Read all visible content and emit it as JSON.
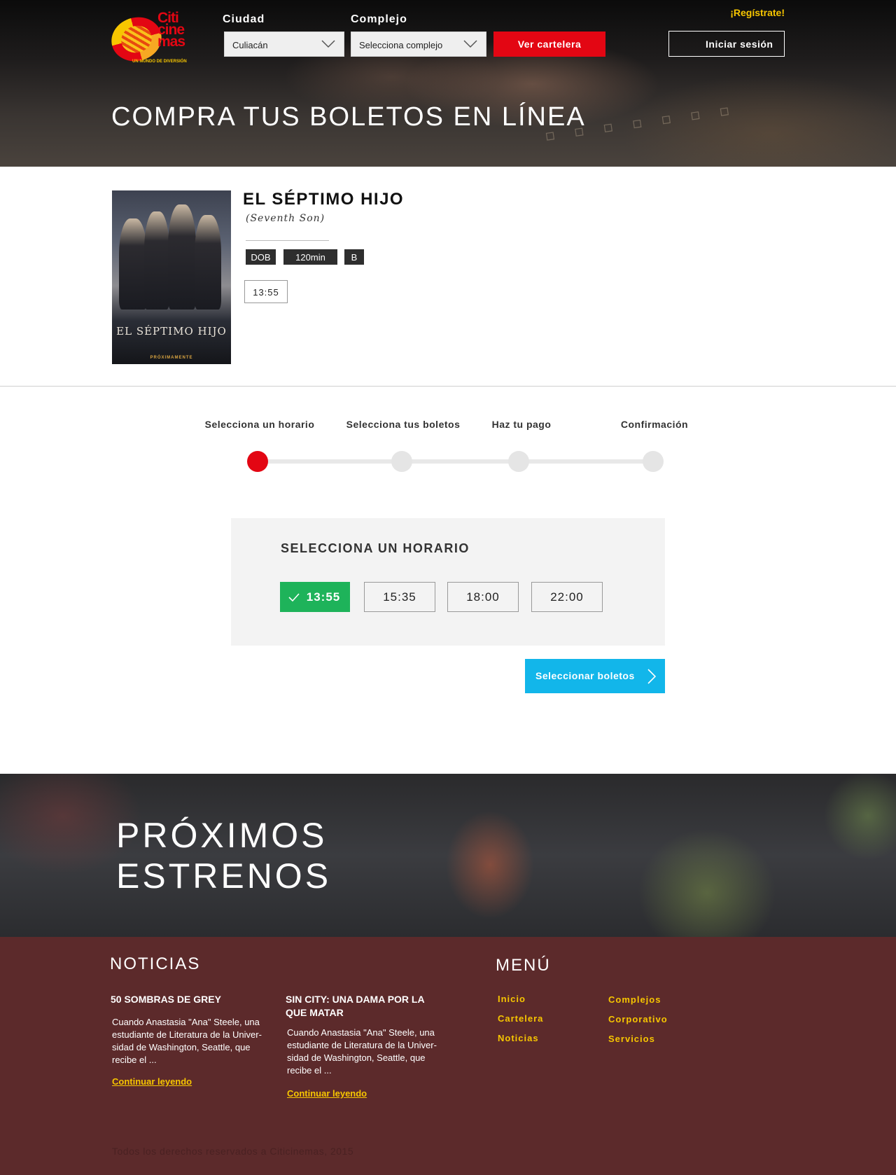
{
  "header": {
    "logo_text": "Citi cine mas",
    "logo_tagline": "UN MUNDO DE DIVERSIÓN",
    "city_label": "Ciudad",
    "city_value": "Culiacán",
    "complex_label": "Complejo",
    "complex_value": "Selecciona complejo",
    "cartelera_button": "Ver cartelera",
    "register_link": "¡Regístrate!",
    "login_button": "Iniciar sesión",
    "hero_title": "COMPRA TUS BOLETOS EN LÍNEA"
  },
  "movie": {
    "title": "EL SÉPTIMO HIJO",
    "original_title": "(Seventh Son)",
    "badges": [
      "DOB",
      "120min",
      "B"
    ],
    "time": "13:55",
    "poster_title": "EL SÉPTIMO HIJO",
    "poster_footer": "PRÓXIMAMENTE"
  },
  "steps": {
    "labels": [
      "Selecciona un horario",
      "Selecciona tus boletos",
      "Haz tu pago",
      "Confirmación"
    ],
    "current": 1
  },
  "schedule": {
    "title": "SELECCIONA UN HORARIO",
    "times": [
      "13:55",
      "15:35",
      "18:00",
      "22:00"
    ],
    "selected": "13:55",
    "next_button": "Seleccionar boletos"
  },
  "upcoming": {
    "line1": "PRÓXIMOS",
    "line2": "ESTRENOS"
  },
  "footer": {
    "news_heading": "NOTICIAS",
    "news": [
      {
        "title": "50 SOMBRAS DE GREY",
        "body": "Cuando Anastasia \"Ana\" Steele, una estudiante de Literatura de la Univer-sidad de Washington, Seattle, que recibe el ...",
        "link": "Continuar leyendo"
      },
      {
        "title": "SIN CITY: UNA DAMA POR LA QUE MATAR",
        "body": "Cuando Anastasia \"Ana\" Steele, una estudiante de Literatura de la Univer-sidad de Washington, Seattle, que recibe el ...",
        "link": "Continuar leyendo"
      }
    ],
    "menu_heading": "MENÚ",
    "menu_col1": [
      "Inicio",
      "Cartelera",
      "Noticias"
    ],
    "menu_col2": [
      "Complejos",
      "Corporativo",
      "Servicios"
    ],
    "copyright": "Todos los derechos reservados a Citicinemas, 2015"
  },
  "colors": {
    "brand_red": "#e30613",
    "accent_yellow": "#f7c600",
    "selected_green": "#1eb35a",
    "action_blue": "#12b6ea",
    "footer_bg": "#5c2a2b"
  }
}
